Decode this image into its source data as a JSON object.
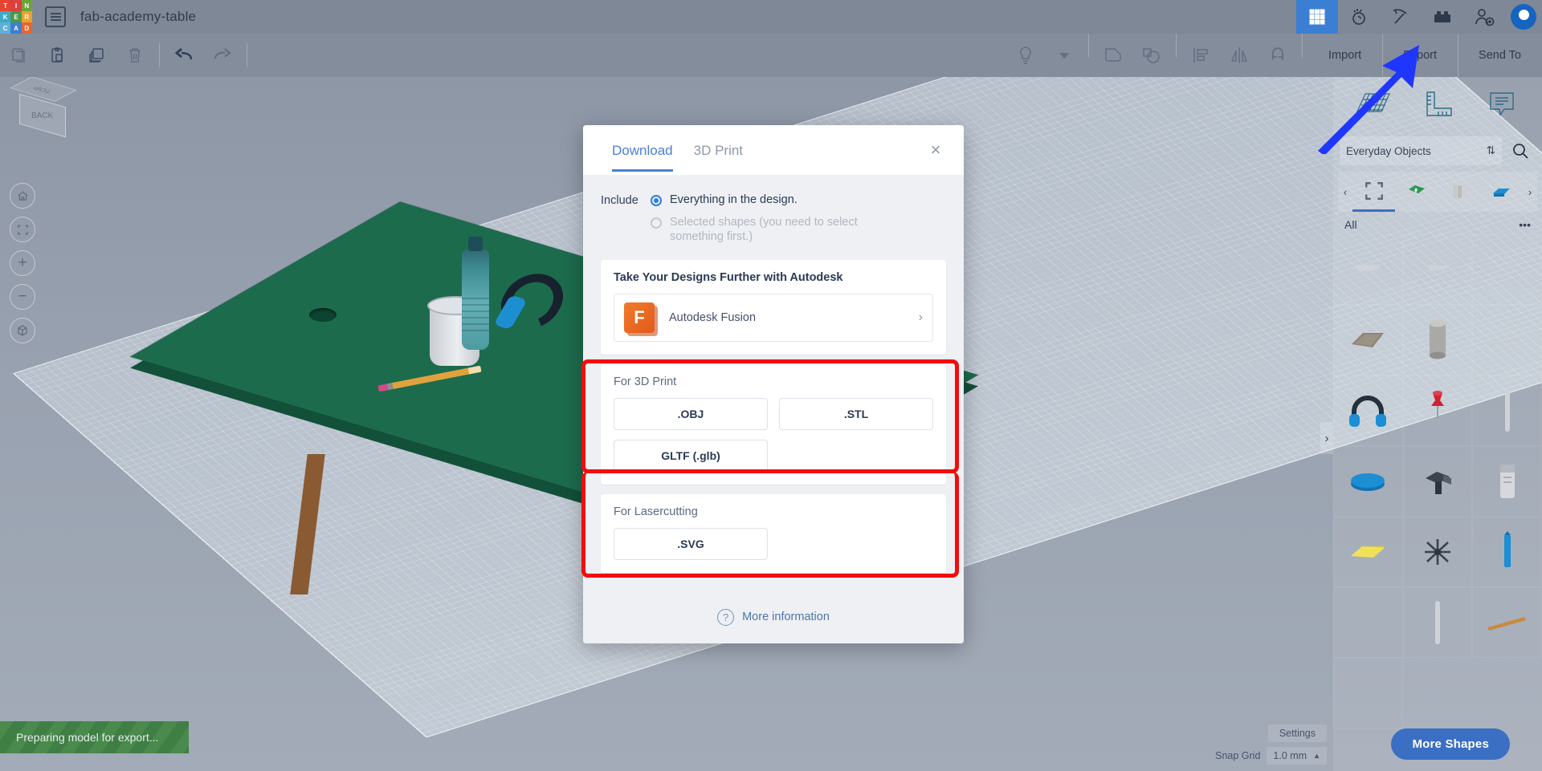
{
  "header": {
    "logo_letters": [
      "T",
      "I",
      "N",
      "K",
      "E",
      "R",
      "C",
      "A",
      "D"
    ],
    "logo_colors": [
      "#e8432f",
      "#f0961e",
      "#4a9a46",
      "#3b7fd4",
      "#e8432f",
      "#f0961e",
      "#4a9a46",
      "#3b7fd4",
      "#e8432f"
    ],
    "doc_icon": "list-icon",
    "title": "fab-academy-table",
    "right_icons": [
      {
        "name": "grid-apps-icon",
        "active": true
      },
      {
        "name": "tinker-lamp-icon",
        "active": false
      },
      {
        "name": "minecraft-pickaxe-icon",
        "active": false
      },
      {
        "name": "lego-blocks-icon",
        "active": false
      },
      {
        "name": "add-person-icon",
        "active": false
      }
    ],
    "avatar": "user-avatar"
  },
  "toolbar": {
    "left_icons": [
      {
        "name": "copy-icon",
        "dim": true
      },
      {
        "name": "paste-icon",
        "dim": false
      },
      {
        "name": "duplicate-icon",
        "dim": false
      },
      {
        "name": "delete-icon",
        "dim": true
      },
      {
        "name": "undo-icon",
        "dim": false
      },
      {
        "name": "redo-icon",
        "dim": true
      }
    ],
    "right_icons": [
      {
        "name": "light-bulb-icon"
      },
      {
        "name": "dropdown-caret-icon"
      },
      {
        "name": "group-icon"
      },
      {
        "name": "ungroup-icon"
      },
      {
        "name": "align-icon"
      },
      {
        "name": "mirror-icon"
      },
      {
        "name": "snap-magnet-icon"
      }
    ],
    "import_label": "Import",
    "export_label": "Export",
    "send_to_label": "Send To"
  },
  "viewcube": {
    "top_face": "TOP",
    "front_face": "BACK",
    "buttons": [
      {
        "name": "home-view-button",
        "glyph": "⌂"
      },
      {
        "name": "fit-view-button",
        "glyph": "⬚"
      },
      {
        "name": "zoom-in-button",
        "glyph": "+"
      },
      {
        "name": "zoom-out-button",
        "glyph": "−"
      },
      {
        "name": "projection-toggle-button",
        "glyph": "⬡"
      }
    ]
  },
  "right_panel": {
    "top_icons": [
      {
        "name": "workplane-icon"
      },
      {
        "name": "ruler-icon"
      },
      {
        "name": "notes-icon"
      }
    ],
    "library_select": "Everyday Objects",
    "search_icon": "search-icon",
    "carousel": [
      {
        "name": "basic-shapes-category",
        "selected": true
      },
      {
        "name": "text-and-numbers-category",
        "selected": false
      },
      {
        "name": "connectors-category",
        "selected": false
      },
      {
        "name": "electronics-category",
        "selected": false
      }
    ],
    "filter_label": "All",
    "overflow_label": "•••",
    "shapes": [
      "dome-shape",
      "dome-shape-2",
      "empty",
      "mat-shape",
      "cylinder-shape",
      "stick-shape",
      "headphones-shape",
      "pushpin-shape",
      "bar-shape",
      "disc-shape",
      "clamp-shape",
      "battery-shape",
      "wedge-shape",
      "fan-shape",
      "marker-shape",
      "rod-shape",
      "pencil-shape",
      "empty2"
    ],
    "more_shapes_label": "More Shapes"
  },
  "grid_settings": {
    "settings_label": "Settings",
    "snap_grid_label": "Snap Grid",
    "snap_grid_value": "1.0 mm",
    "caret": "▲"
  },
  "toast": {
    "message": "Preparing model for export..."
  },
  "modal": {
    "tabs": [
      {
        "label": "Download",
        "active": true
      },
      {
        "label": "3D Print",
        "active": false
      }
    ],
    "close_glyph": "×",
    "include_label": "Include",
    "options": [
      {
        "label": "Everything in the design.",
        "selected": true,
        "disabled": false
      },
      {
        "label": "Selected shapes (you need to select something first.)",
        "selected": false,
        "disabled": true
      }
    ],
    "autodesk_card": {
      "heading": "Take Your Designs Further with Autodesk",
      "item_label": "Autodesk Fusion",
      "item_icon_letter": "F",
      "chevron": "›"
    },
    "print_card": {
      "heading": "For 3D Print",
      "buttons": [
        ".OBJ",
        ".STL",
        "GLTF (.glb)"
      ]
    },
    "laser_card": {
      "heading": "For Lasercutting",
      "buttons": [
        ".SVG"
      ]
    },
    "footer": {
      "icon": "help-circle-icon",
      "icon_glyph": "?",
      "label": "More information"
    }
  },
  "annotations": {
    "highlight_color": "#f40c0c",
    "arrow_color": "#1f36ff",
    "arrow_target": "Export"
  }
}
